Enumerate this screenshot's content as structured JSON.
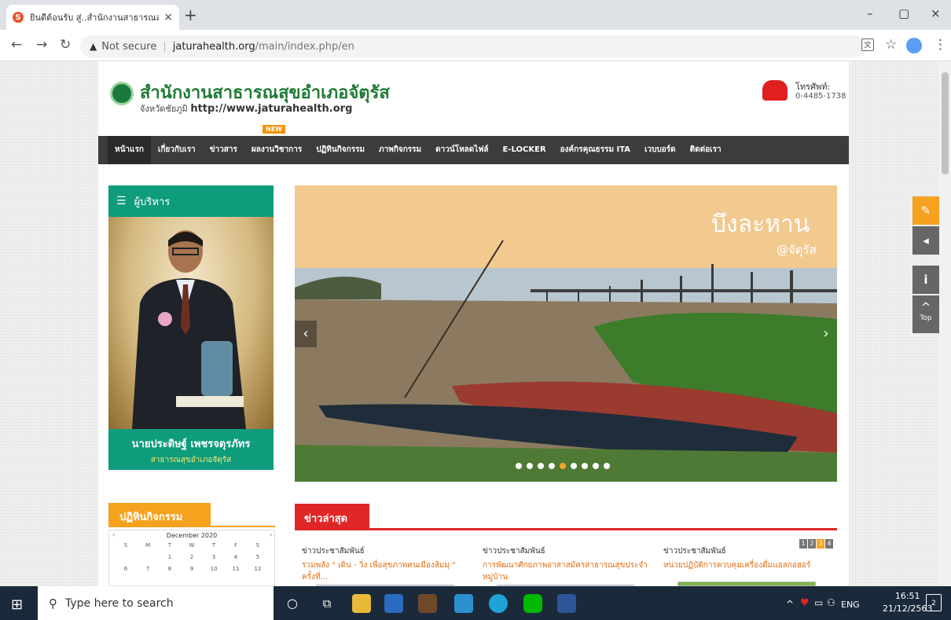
{
  "browser": {
    "tab_title": "ยินดีต้อนรับ สู่..สำนักงานสาธารณสุขอำ",
    "tab_close": "×",
    "new_tab": "+",
    "not_secure": "Not secure",
    "url_host": "jaturahealth.org",
    "url_path": "/main/index.php/en",
    "window_minimize": "–",
    "window_restore": "▢",
    "window_close": "×"
  },
  "site": {
    "title": "สำนักงานสาธารณสุขอำเภอจัตุรัส",
    "province": "จังหวัดชัยภูมิ",
    "url": "http://www.jaturahealth.org",
    "phone_label": "โทรศัพท์:",
    "phone_number": "0-4485-1738"
  },
  "nav": {
    "items": [
      "หน้าแรก",
      "เกี่ยวกับเรา",
      "ข่าวสาร",
      "ผลงานวิชาการ",
      "ปฏิทินกิจกรรม",
      "ภาพกิจกรรม",
      "ดาวน์โหลดไฟล์",
      "E-LOCKER",
      "องค์กรคุณธรรม ITA",
      "เวบบอร์ด",
      "ติดต่อเรา"
    ],
    "new_badge": "NEW"
  },
  "executive": {
    "heading": "ผู้บริหาร",
    "name": "นายประดิษฐ์ เพชรจตุรภัทร",
    "position": "สาธารณสุขอำเภอจัตุรัส"
  },
  "slider": {
    "title": "บึงละหาน",
    "subtitle": "@จัตุรัส",
    "dots": 9,
    "active_dot": 4
  },
  "activities": {
    "heading": "ปฏิทินกิจกรรม",
    "month": "December 2020",
    "weekdays": [
      "S",
      "M",
      "T",
      "W",
      "T",
      "F",
      "S"
    ],
    "days": [
      "",
      "",
      "1",
      "2",
      "3",
      "4",
      "5",
      "6",
      "7",
      "8",
      "9",
      "10",
      "11",
      "12"
    ]
  },
  "news": {
    "heading": "ข่าวล่าสุด",
    "pages": [
      "1",
      "2",
      "3",
      "4"
    ],
    "active_page": "3",
    "items": [
      {
        "category": "ข่าวประชาสัมพันธ์",
        "title": "รวมพลัง \" เดิน - วิ่ง เพื่อสุขภาพคนเมืองส้มมุ \" ครั้งที่..."
      },
      {
        "category": "ข่าวประชาสัมพันธ์",
        "title": "การพัฒนาศักยภาพอาสาสมัครสาธารณสุขประจำหมู่บ้าน"
      },
      {
        "category": "ข่าวประชาสัมพันธ์",
        "title": "หน่วยปฏิบัติการควบคุมเครื่องดื่มแอลกอฮอร์"
      }
    ]
  },
  "side_tools": {
    "top_label": "Top"
  },
  "taskbar": {
    "search_placeholder": "Type here to search",
    "lang": "ENG",
    "time": "16:51",
    "date": "21/12/2563",
    "notifications": "2"
  },
  "colors": {
    "green": "#0e9c7d",
    "orange": "#f5a21f",
    "red": "#e02727",
    "nav": "#3c3c3c"
  }
}
